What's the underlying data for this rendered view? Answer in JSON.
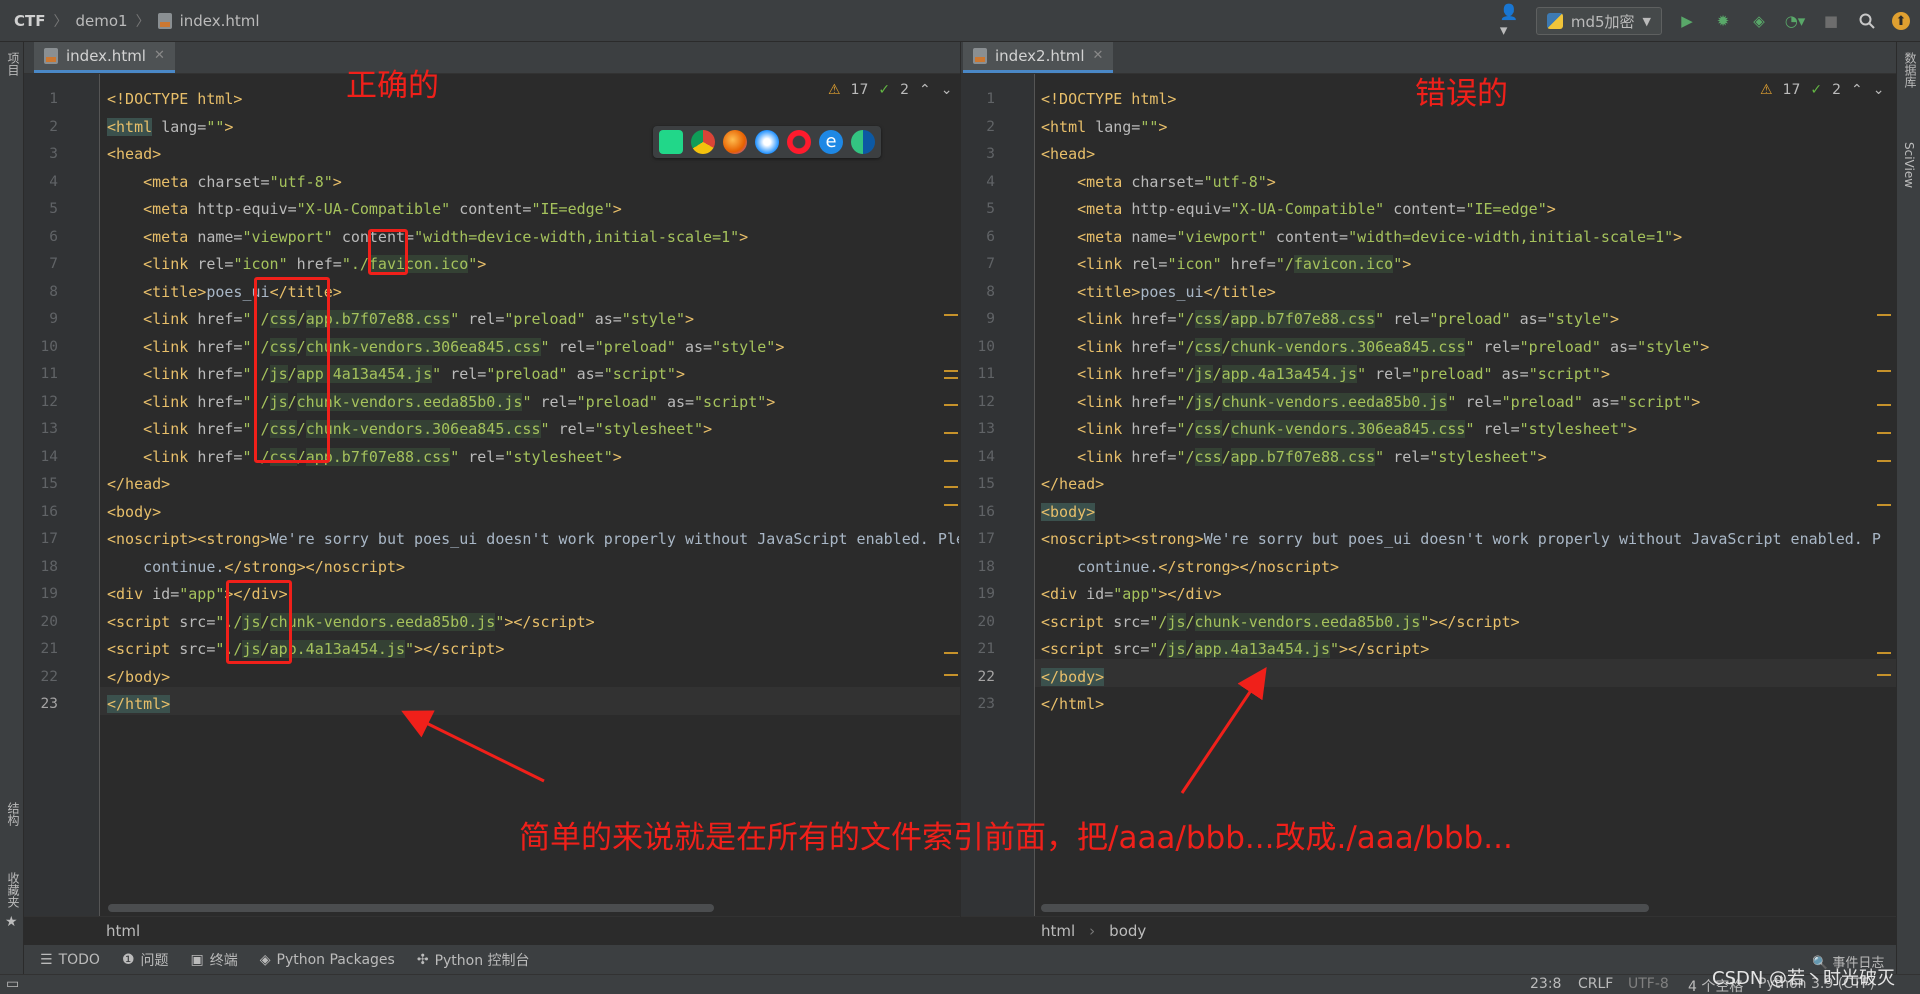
{
  "titlebar": {
    "breadcrumbs": [
      "CTF",
      "demo1",
      "index.html"
    ],
    "run_config": "md5加密"
  },
  "left_strip": {
    "project": "项目",
    "structure": "结构",
    "bookmarks": "收藏夹"
  },
  "right_strip": {
    "database": "数据库",
    "sciview": "SciView"
  },
  "left_editor": {
    "tab": "index.html",
    "warnings": "17",
    "checks": "2",
    "breadcrumb": [
      "html"
    ],
    "current_line": 23
  },
  "right_editor": {
    "tab": "index2.html",
    "warnings": "17",
    "checks": "2",
    "breadcrumb": [
      "html",
      "body"
    ],
    "current_line": 22
  },
  "annotations": {
    "left_label": "正确的",
    "right_label": "错误的",
    "summary": "简单的来说就是在所有的文件索引前面，把/aaa/bbb...改成./aaa/bbb..."
  },
  "tool_windows": [
    "TODO",
    "问题",
    "终端",
    "Python Packages",
    "Python 控制台"
  ],
  "status": {
    "position": "23:8",
    "line_sep": "CRLF",
    "encoding": "UTF-8",
    "indent": "4 个空格",
    "interpreter": "Python 3.9 (CTF)",
    "event_log": "事件日志",
    "watermark": "CSDN @若丶时光破灭"
  },
  "colors": {
    "accent": "#4a88c7",
    "annotation": "#f0201a",
    "tag": "#e8bf6a",
    "string": "#a5c25c"
  }
}
